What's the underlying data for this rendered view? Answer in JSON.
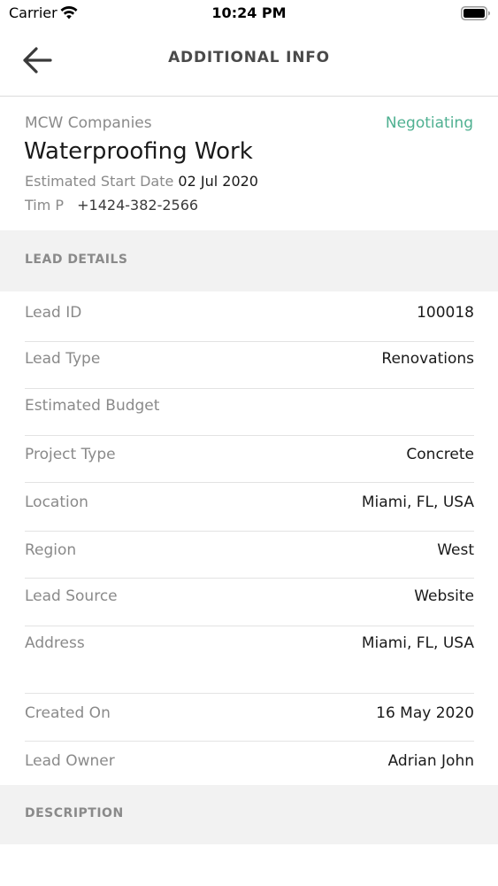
{
  "status_bar": {
    "carrier": "Carrier",
    "time": "10:24 PM",
    "wifi_icon": "wifi-icon",
    "battery_icon": "battery-icon"
  },
  "nav": {
    "back_icon": "arrow-left-icon",
    "title": "ADDITIONAL INFO"
  },
  "summary": {
    "company": "MCW Companies",
    "status": "Negotiating",
    "title": "Waterproofing Work",
    "start_label": "Estimated Start Date",
    "start_value": "02 Jul 2020",
    "contact_name": "Tim P",
    "contact_phone": "+1424-382-2566"
  },
  "lead_details": {
    "header": "LEAD DETAILS",
    "rows": [
      {
        "label": "Lead ID",
        "value": "100018"
      },
      {
        "label": "Lead Type",
        "value": "Renovations"
      },
      {
        "label": "Estimated Budget",
        "value": ""
      },
      {
        "label": "Project Type",
        "value": "Concrete"
      },
      {
        "label": "Location",
        "value": "Miami, FL, USA"
      },
      {
        "label": "Region",
        "value": "West"
      },
      {
        "label": "Lead Source",
        "value": "Website"
      },
      {
        "label": "Address",
        "value": "Miami, FL, USA"
      },
      {
        "label": "Created On",
        "value": "16 May 2020"
      },
      {
        "label": "Lead Owner",
        "value": "Adrian John"
      }
    ]
  },
  "description": {
    "header": "DESCRIPTION"
  },
  "colors": {
    "status_green": "#4fb091",
    "section_bg": "#f2f2f2",
    "muted_text": "#8a8a8a"
  }
}
